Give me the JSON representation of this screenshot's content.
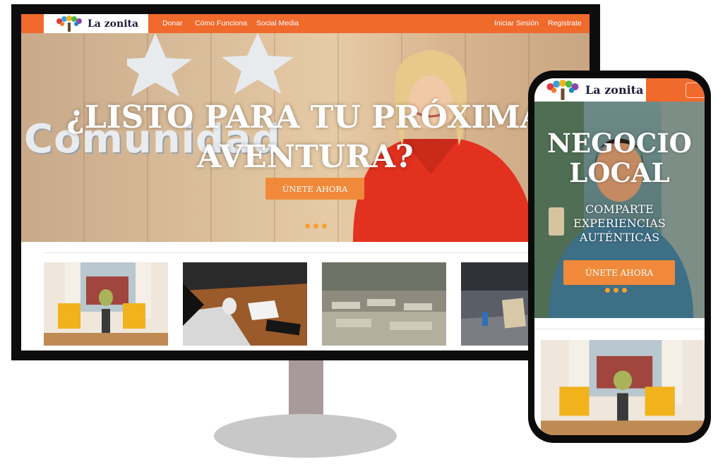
{
  "site": {
    "logo_text": "La zonita",
    "nav_left": [
      "Donar",
      "Cómo Funciona",
      "Social Media"
    ],
    "nav_right": [
      "Iniciar Sesión",
      "Registrate"
    ]
  },
  "desktop_hero": {
    "wall_sign": "Comunidad",
    "title_line1": "¿LISTO PARA TU PRÓXIMA",
    "title_line2": "AVENTURA?",
    "cta_label": "ÚNETE AHORA",
    "carousel_dots": 3
  },
  "desktop_cards": [
    {
      "image": "living-room-yellow-chairs"
    },
    {
      "image": "desk-laptop-coffee"
    },
    {
      "image": "empty-classroom"
    },
    {
      "image": "street-homeless-sign"
    }
  ],
  "mobile_hero": {
    "title_line1": "NEGOCIO",
    "title_line2": "LOCAL",
    "subtitle_line1": "COMPARTE",
    "subtitle_line2": "EXPERIENCIAS",
    "subtitle_line3": "AUTÉNTICAS",
    "cta_label": "ÚNETE AHORA",
    "carousel_dots": 3
  },
  "colors": {
    "brand_orange": "#f06a2c",
    "button_orange": "#f08a3a",
    "dot_orange": "#f7a030",
    "monitor_bezel": "#0c0c0c",
    "stand": "#a89a9a"
  },
  "icons": [
    "tree-logo-icon",
    "hamburger-menu-icon"
  ]
}
